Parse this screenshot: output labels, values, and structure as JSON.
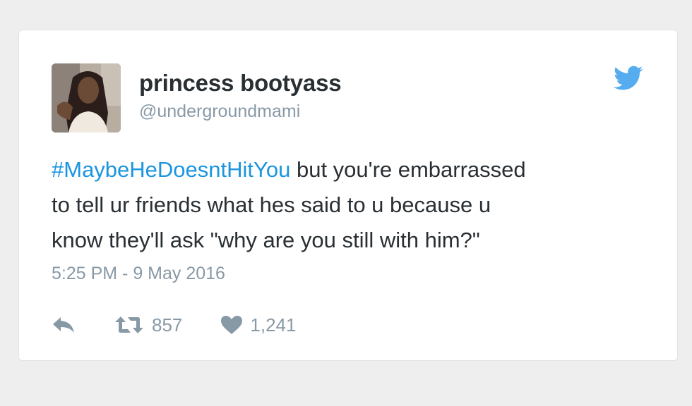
{
  "user": {
    "display_name": "princess bootyass",
    "handle": "@undergroundmami"
  },
  "tweet": {
    "hashtag": "#MaybeHeDoesntHitYou",
    "line1_rest": " but you're embarrassed",
    "line2": "to tell ur friends what hes said to u because u",
    "line3": "know they'll ask \"why are you still with him?\"",
    "timestamp": "5:25 PM - 9 May 2016"
  },
  "stats": {
    "retweets": "857",
    "likes": "1,241"
  },
  "icons": {
    "brand": "twitter-bird-icon",
    "reply": "reply-icon",
    "retweet": "retweet-icon",
    "like": "heart-icon"
  },
  "colors": {
    "link": "#1b95e0",
    "text": "#292f33",
    "muted": "#8899a6",
    "brand": "#55acee"
  }
}
